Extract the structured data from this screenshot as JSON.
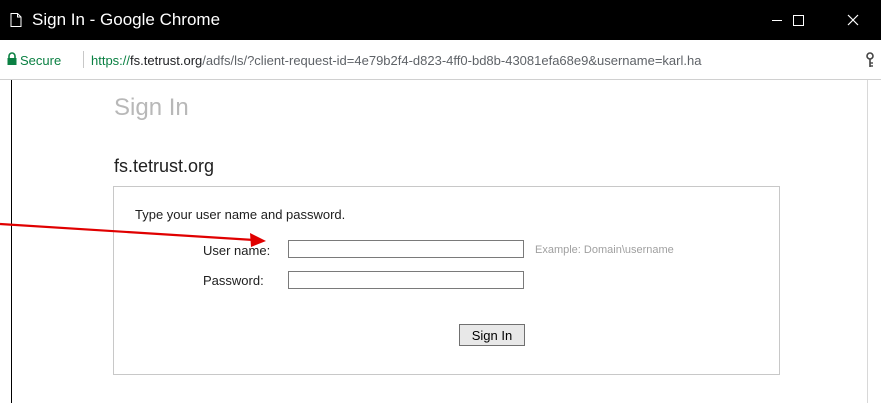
{
  "window": {
    "title": "Sign In - Google Chrome",
    "icons": [
      "page-icon",
      "minimize-icon",
      "maximize-icon",
      "close-icon"
    ]
  },
  "address_bar": {
    "secure_label": "Secure",
    "url_scheme": "https://",
    "url_host": "fs.tetrust.org",
    "url_path": "/adfs/ls/?client-request-id=4e79b2f4-d823-4ff0-bd8b-43081efa68e9&username=karl.ha",
    "icons": [
      "lock-icon",
      "key-icon"
    ]
  },
  "page": {
    "title": "Sign In",
    "site_name": "fs.tetrust.org",
    "instructions": "Type your user name and password.",
    "username_label": "User name:",
    "username_value": "",
    "username_example": "Example: Domain\\username",
    "password_label": "Password:",
    "password_value": "",
    "submit_label": "Sign In"
  },
  "annotation": {
    "arrow_color": "#e00000"
  },
  "colors": {
    "secure_green": "#0b8043",
    "titlebar": "#000000"
  }
}
